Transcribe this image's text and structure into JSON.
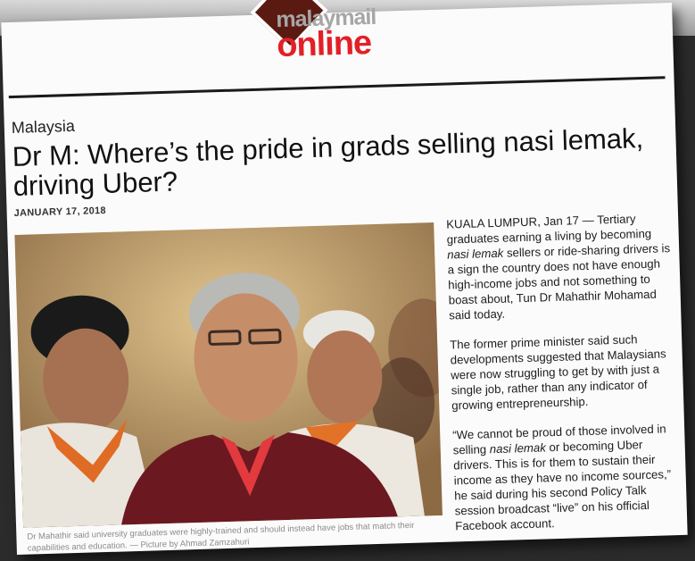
{
  "masthead": {
    "logo_top": "malaymail",
    "logo_bottom": "online"
  },
  "article": {
    "section": "Malaysia",
    "headline": "Dr M: Where’s the pride in grads selling nasi lemak, driving Uber?",
    "date": "JANUARY 17, 2018",
    "photo_caption": "Dr Mahathir said university graduates were highly-trained and should instead have jobs that match their capabilities and education. — Picture by Ahmad Zamzahuri",
    "p1_a": "KUALA LUMPUR, Jan 17 — Tertiary graduates earning a living by becoming ",
    "p1_em": "nasi lemak",
    "p1_b": " sellers or ride-sharing drivers is a sign the country does not have enough high-income jobs and not something to boast about, Tun Dr Mahathir Mohamad said today.",
    "p2": "The former prime minister said such developments suggested that Malaysians were now struggling to get by with just a single job, rather than any indicator of growing entrepreneurship.",
    "p3_a": "“We cannot be proud of those involved in selling ",
    "p3_em": "nasi lemak",
    "p3_b": " or becoming Uber drivers. This is for them to sustain their income as they have no income sources,” he said during his second Policy Talk session broadcast “live” on his official Facebook account."
  }
}
